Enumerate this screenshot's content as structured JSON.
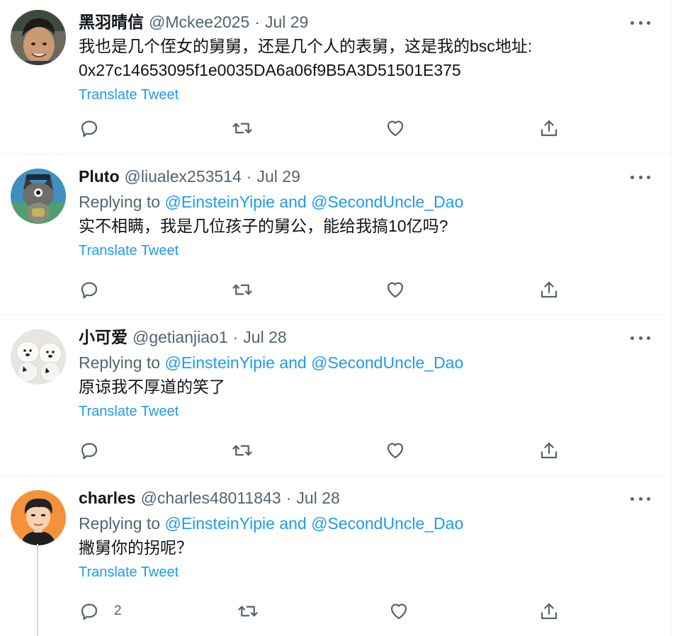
{
  "translate_label": "Translate Tweet",
  "colors": {
    "link": "#1d9bf0",
    "muted": "#536471",
    "text": "#0f1419",
    "divider": "#eff3f4"
  },
  "icons": {
    "reply": "reply-bubble-icon",
    "retweet": "retweet-arrows-icon",
    "like": "heart-icon",
    "share": "share-upload-icon",
    "more": "more-dots-icon"
  },
  "tweets": [
    {
      "name": "黑羽晴信",
      "handle": "@Mckee2025",
      "separator": "·",
      "date": "Jul 29",
      "replying_prefix": "",
      "replying_to": "",
      "text": "我也是几个侄女的舅舅，还是几个人的表舅，这是我的bsc地址:\n0x27c14653095f1e0035DA6a06f9B5A3D51501E375",
      "reply_count": ""
    },
    {
      "name": "Pluto",
      "handle": "@liualex253514",
      "separator": "·",
      "date": "Jul 29",
      "replying_prefix": "Replying to",
      "replying_to": "@EinsteinYipie and @SecondUncle_Dao",
      "text": "实不相瞒，我是几位孩子的舅公，能给我搞10亿吗?",
      "reply_count": ""
    },
    {
      "name": "小可爱",
      "handle": "@getianjiao1",
      "separator": "·",
      "date": "Jul 28",
      "replying_prefix": "Replying to",
      "replying_to": "@EinsteinYipie and @SecondUncle_Dao",
      "text": "原谅我不厚道的笑了",
      "reply_count": ""
    },
    {
      "name": "charles",
      "handle": "@charles48011843",
      "separator": "·",
      "date": "Jul 28",
      "replying_prefix": "Replying to",
      "replying_to": "@EinsteinYipie and @SecondUncle_Dao",
      "text": "撇舅你的拐呢？",
      "reply_count": "2"
    }
  ]
}
